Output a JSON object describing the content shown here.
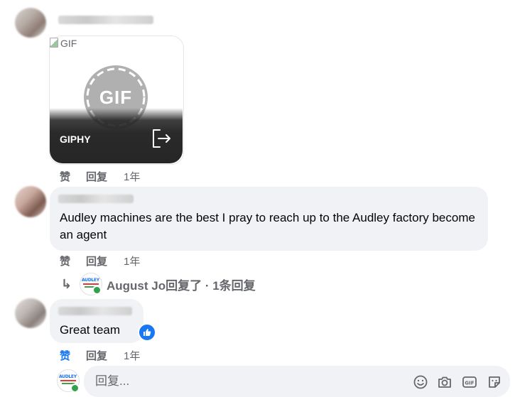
{
  "gif_comment": {
    "broken_alt": "GIF",
    "circle_label": "GIF",
    "provider": "GIPHY",
    "actions": {
      "like": "赞",
      "reply": "回复",
      "time": "1年"
    }
  },
  "comment_2": {
    "text": "Audley machines are the best I pray to reach up to the Audley factory become an agent",
    "actions": {
      "like": "赞",
      "reply": "回复",
      "time": "1年"
    },
    "replies_summary": "August Jo回复了 · 1条回复",
    "replies_icon": "reply-arrow-icon"
  },
  "comment_3": {
    "text": "Great team",
    "liked": true,
    "reaction_icon": "thumbs-up-icon",
    "actions": {
      "like": "赞",
      "reply": "回复",
      "time": "1年"
    }
  },
  "composer": {
    "placeholder": "回复...",
    "tools": [
      "smiley-icon",
      "camera-icon",
      "gif-icon",
      "sticker-icon"
    ]
  },
  "colors": {
    "bubble": "#f0f2f5",
    "secondary_text": "#65676b",
    "like_blue": "#1877f2",
    "online_green": "#31a24c"
  }
}
